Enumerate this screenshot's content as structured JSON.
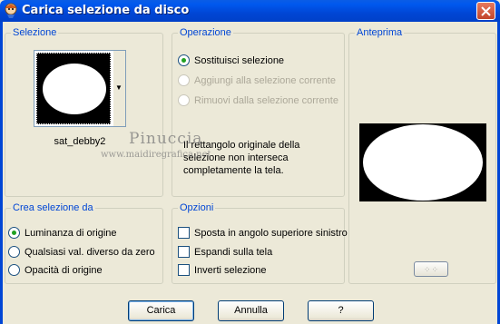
{
  "window": {
    "title": "Carica selezione da disco",
    "title_icon": "paint-shop-pro-icon",
    "close_icon": "close-icon"
  },
  "selezione": {
    "title": "Selezione",
    "thumbnail_name": "sat_debby2",
    "dropdown_icon": "chevron-down-icon"
  },
  "operazione": {
    "title": "Operazione",
    "options": [
      {
        "label": "Sostituisci selezione",
        "checked": true,
        "enabled": true
      },
      {
        "label": "Aggiungi alla selezione corrente",
        "checked": false,
        "enabled": false
      },
      {
        "label": "Rimuovi dalla selezione corrente",
        "checked": false,
        "enabled": false
      }
    ],
    "info_text": "Il rettangolo originale della selezione non interseca completamente la tela."
  },
  "anteprima": {
    "title": "Anteprima",
    "toggle_button_icon": "dotted-grid-icon"
  },
  "crea": {
    "title": "Crea selezione da",
    "options": [
      {
        "label": "Luminanza di origine",
        "checked": true
      },
      {
        "label": "Qualsiasi val. diverso da zero",
        "checked": false
      },
      {
        "label": "Opacità di origine",
        "checked": false
      }
    ]
  },
  "opzioni": {
    "title": "Opzioni",
    "options": [
      {
        "label": "Sposta in angolo superiore sinistro",
        "checked": false
      },
      {
        "label": "Espandi sulla tela",
        "checked": false
      },
      {
        "label": "Inverti selezione",
        "checked": false
      }
    ]
  },
  "buttons": {
    "load": "Carica",
    "cancel": "Annulla",
    "help": "?"
  },
  "watermark": {
    "name": "Pinuccia",
    "site": "www.maidiregrafica.net"
  },
  "colors": {
    "titlebar": "#0046d5",
    "face": "#ece9d8",
    "group_title": "#0046d5"
  }
}
